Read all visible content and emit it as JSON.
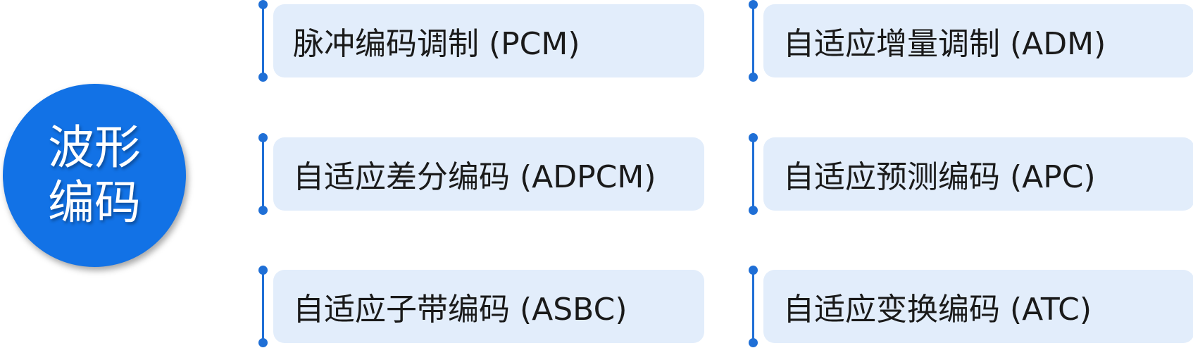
{
  "hub": {
    "label": "波形编码"
  },
  "items": [
    {
      "label": "脉冲编码调制 (PCM)"
    },
    {
      "label": "自适应差分编码 (ADPCM)"
    },
    {
      "label": "自适应子带编码 (ASBC)"
    },
    {
      "label": "自适应增量调制 (ADM)"
    },
    {
      "label": "自适应预测编码 (APC)"
    },
    {
      "label": "自适应变换编码 (ATC)"
    }
  ],
  "colors": {
    "hub": "#1272e6",
    "box": "#e2edfb",
    "rail": "#1f6fd6",
    "text": "#1a1a1a"
  }
}
